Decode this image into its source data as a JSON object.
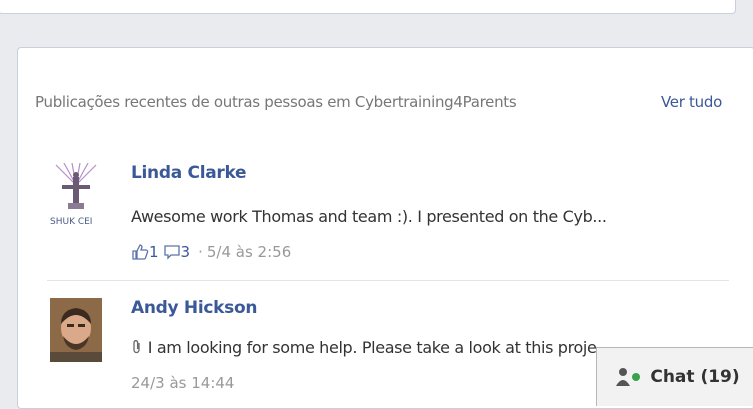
{
  "group": {
    "header": "Publicações recentes de outras pessoas em Cybertraining4Parents",
    "see_all": "Ver tudo"
  },
  "posts": [
    {
      "author": "Linda Clarke",
      "avatar_caption": "SHUK CEI",
      "text": "Awesome work Thomas and team :). I presented on the Cyb...",
      "likes": "1",
      "comments": "3",
      "timestamp": "5/4 às 2:56"
    },
    {
      "author": "Andy Hickson",
      "text": "I am looking for some help. Please take a look at this proje...",
      "timestamp": "24/3 às 14:44"
    }
  ],
  "chat": {
    "label": "Chat",
    "count": "(19)"
  },
  "colors": {
    "link": "#3b5998",
    "page_bg": "#e9ebee",
    "online_green": "#3aa24a"
  }
}
